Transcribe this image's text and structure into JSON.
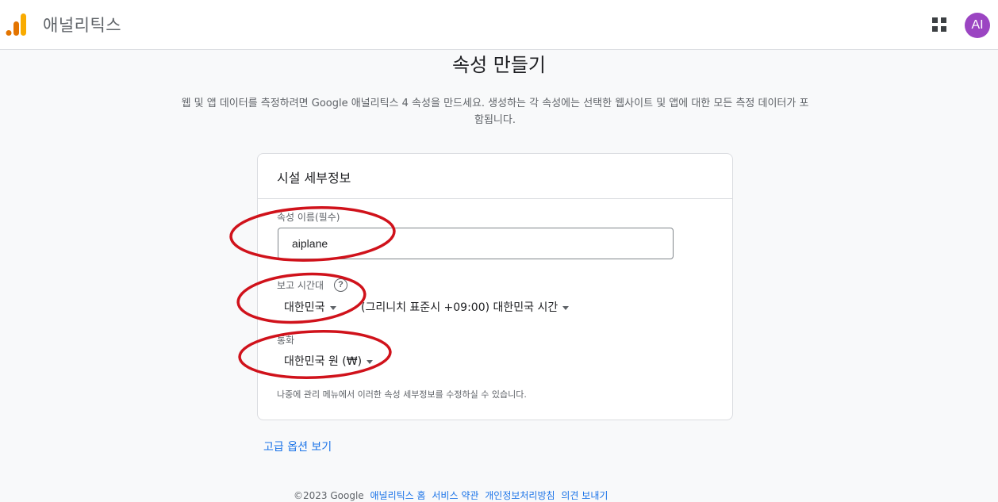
{
  "header": {
    "app_title": "애널리틱스",
    "avatar_initials": "AI"
  },
  "page": {
    "title": "속성 만들기",
    "description": "웹 및 앱 데이터를 측정하려면 Google 애널리틱스 4 속성을 만드세요. 생성하는 각 속성에는 선택한 웹사이트 및 앱에 대한 모든 측정 데이터가 포함됩니다."
  },
  "card": {
    "title": "시설 세부정보",
    "property_name_label": "속성 이름(필수)",
    "property_name_value": "aiplane",
    "timezone_label": "보고 시간대",
    "timezone_country": "대한민국",
    "timezone_value": "(그리니치 표준시 +09:00) 대한민국 시간",
    "currency_label": "통화",
    "currency_value": "대한민국 원 (₩)",
    "hint": "나중에 관리 메뉴에서 이러한 속성 세부정보를 수정하실 수 있습니다."
  },
  "advanced_link": "고급 옵션 보기",
  "footer": {
    "copyright": "©2023 Google",
    "links": [
      "애널리틱스 홈",
      "서비스 약관",
      "개인정보처리방침",
      "의견 보내기"
    ]
  },
  "colors": {
    "accent": "#1a73e8",
    "avatar": "#9b45c2",
    "annotation": "#d0121b"
  }
}
